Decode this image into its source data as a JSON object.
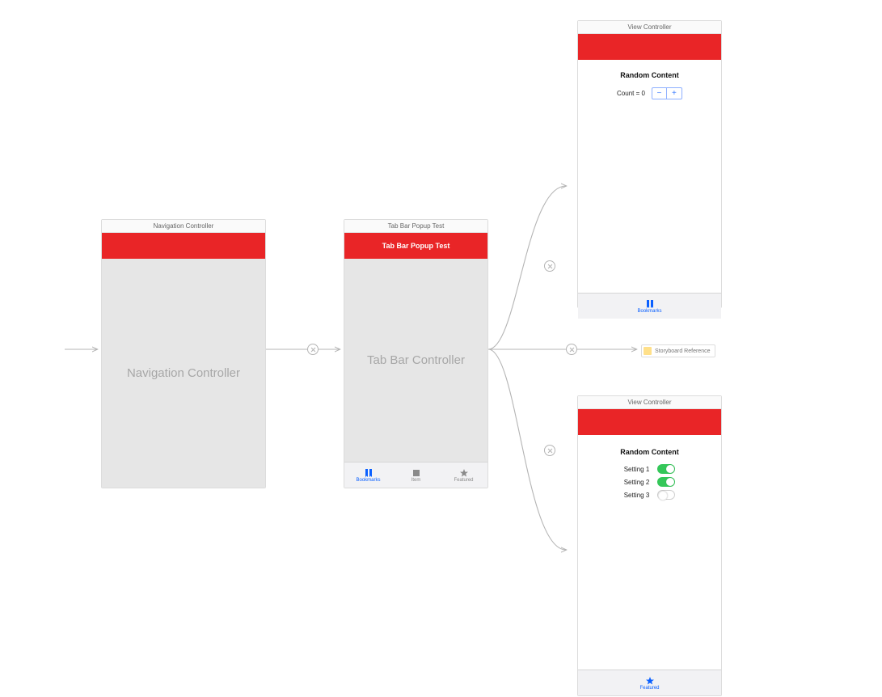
{
  "scenes": {
    "nav": {
      "title": "Navigation Controller",
      "body_label": "Navigation Controller"
    },
    "tabctrl": {
      "title": "Tab Bar Popup Test",
      "nav_title": "Tab Bar Popup Test",
      "body_label": "Tab Bar Controller",
      "tabs": [
        {
          "label": "Bookmarks",
          "icon": "bookmark",
          "active": true
        },
        {
          "label": "Item",
          "icon": "square",
          "active": false
        },
        {
          "label": "Featured",
          "icon": "star",
          "active": false
        }
      ]
    },
    "vc_top": {
      "title": "View Controller",
      "heading": "Random Content",
      "count_label": "Count = 0",
      "tabs": [
        {
          "label": "Bookmarks",
          "icon": "bookmark",
          "active": true
        }
      ]
    },
    "vc_bottom": {
      "title": "View Controller",
      "heading": "Random Content",
      "settings": [
        {
          "label": "Setting 1",
          "on": true
        },
        {
          "label": "Setting 2",
          "on": true
        },
        {
          "label": "Setting 3",
          "on": false
        }
      ],
      "tabs": [
        {
          "label": "Featured",
          "icon": "star",
          "active": true
        }
      ]
    },
    "storyboard_ref": "Storyboard Reference"
  }
}
